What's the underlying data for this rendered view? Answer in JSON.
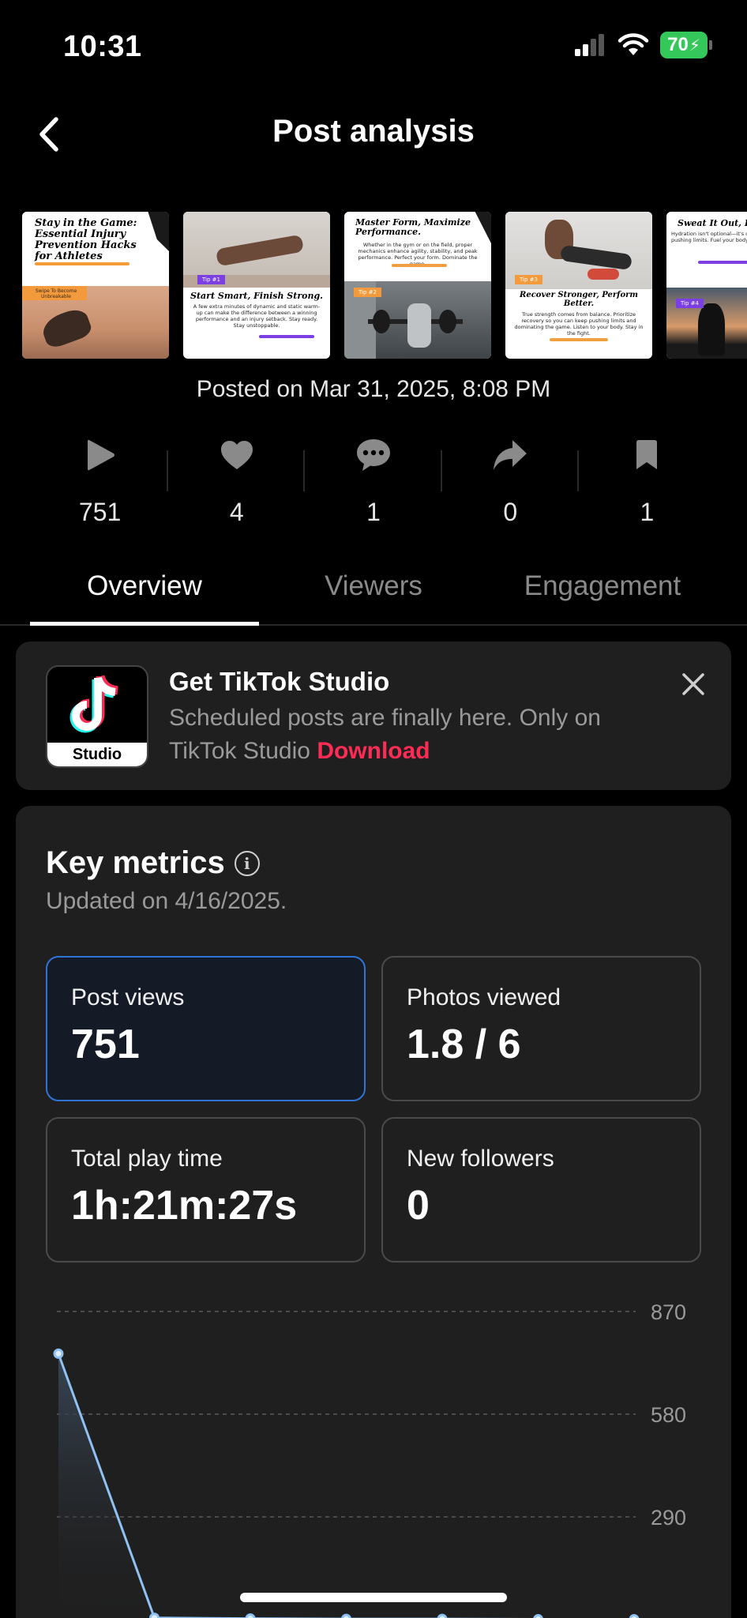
{
  "status_bar": {
    "time": "10:31",
    "battery": "70"
  },
  "header": {
    "title": "Post analysis"
  },
  "thumbnails": [
    {
      "title": "Stay in the Game: Essential Injury Prevention Hacks for Athletes",
      "tag": "Swipe To Become Unbreakable"
    },
    {
      "title": "Start Smart, Finish Strong.",
      "tag": "Tip #1",
      "body": "A few extra minutes of dynamic and static warm-up can make the difference between a winning performance and an injury setback. Stay ready. Stay unstoppable."
    },
    {
      "title": "Master Form, Maximize Performance.",
      "tag": "Tip #2",
      "body": "Whether in the gym or on the field, proper mechanics enhance agility, stability, and peak performance. Perfect your form. Dominate the game."
    },
    {
      "title": "Recover Stronger, Perform Better.",
      "tag": "Tip #3",
      "body": "True strength comes from balance. Prioritize recovery so you can keep pushing limits and dominating the game. Listen to your body. Stay in the fight."
    },
    {
      "title": "Sweat It Out, Drink",
      "tag": "Tip #4",
      "body": "Hydration isn't optional—it's dehydration, keep pushing limits. Fuel your body. Stay"
    }
  ],
  "posted_on": "Posted on Mar 31, 2025, 8:08 PM",
  "stats": [
    {
      "icon": "play-icon",
      "value": "751"
    },
    {
      "icon": "heart-icon",
      "value": "4"
    },
    {
      "icon": "comment-icon",
      "value": "1"
    },
    {
      "icon": "share-icon",
      "value": "0"
    },
    {
      "icon": "bookmark-icon",
      "value": "1"
    }
  ],
  "tabs": [
    {
      "label": "Overview",
      "active": true
    },
    {
      "label": "Viewers",
      "active": false
    },
    {
      "label": "Engagement",
      "active": false
    }
  ],
  "promo": {
    "logo_label": "Studio",
    "title": "Get TikTok Studio",
    "body": "Scheduled posts are finally here. Only on TikTok Studio",
    "link": "Download"
  },
  "metrics": {
    "title": "Key metrics",
    "updated": "Updated on 4/16/2025.",
    "items": [
      {
        "label": "Post views",
        "value": "751",
        "selected": true
      },
      {
        "label": "Photos viewed",
        "value": "1.8 / 6",
        "selected": false
      },
      {
        "label": "Total play time",
        "value": "1h:21m:27s",
        "selected": false
      },
      {
        "label": "New followers",
        "value": "0",
        "selected": false
      }
    ]
  },
  "chart_data": {
    "type": "area",
    "y_ticks": [
      "870",
      "580",
      "290"
    ],
    "ylim": [
      0,
      870
    ],
    "series": [
      {
        "values": [
          751,
          5,
          3,
          2,
          2,
          1,
          1
        ]
      }
    ],
    "line_color": "#8fc2f2"
  }
}
